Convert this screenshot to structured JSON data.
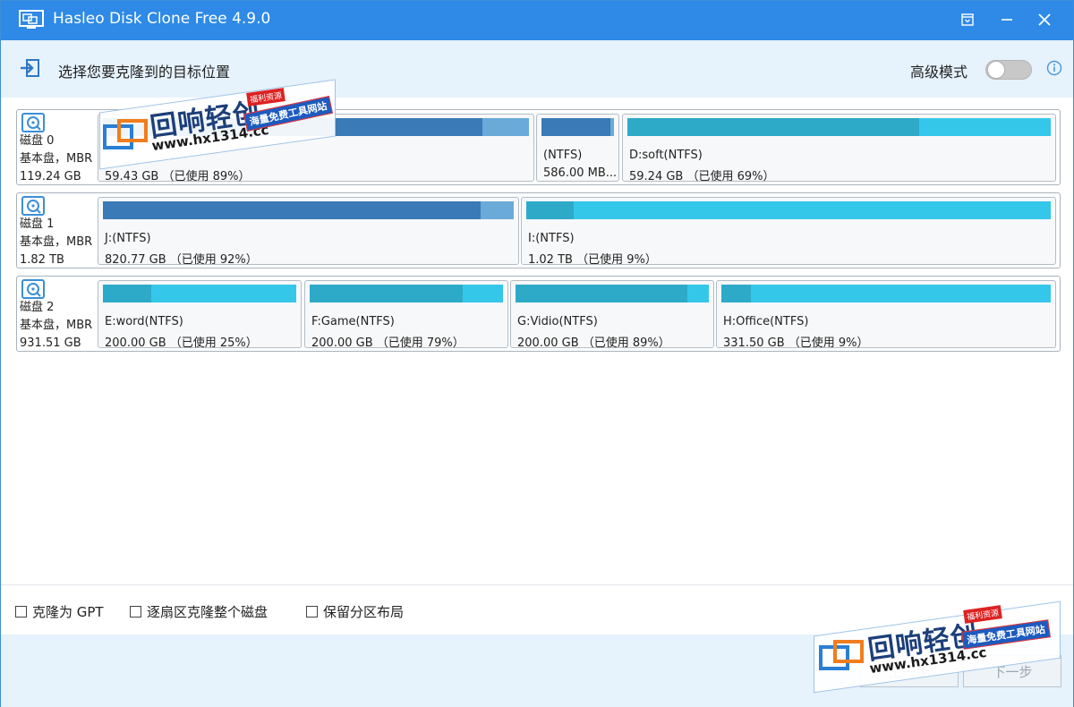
{
  "window": {
    "title": "Hasleo Disk Clone Free 4.9.0"
  },
  "titlebar": {
    "icons": [
      "app-icon",
      "restore-icon",
      "minimize-icon",
      "close-icon"
    ]
  },
  "header": {
    "step_label": "选择您要克隆到的目标位置",
    "advanced_label": "高级模式",
    "advanced_on": false
  },
  "disks": [
    {
      "name": "磁盘 0",
      "type": "基本盘，MBR",
      "size": "119.24 GB",
      "partitions": [
        {
          "label": "",
          "size_text": "59.43 GB （已使用 89%）",
          "used": 0.89,
          "style": "dark"
        },
        {
          "label": "(NTFS)",
          "size_text": "586.00 MB...",
          "used": 0.95,
          "style": "dark"
        },
        {
          "label": "D:soft(NTFS)",
          "size_text": "59.24 GB （已使用 69%）",
          "used": 0.69,
          "style": "light"
        }
      ]
    },
    {
      "name": "磁盘 1",
      "type": "基本盘，MBR",
      "size": "1.82 TB",
      "partitions": [
        {
          "label": "J:(NTFS)",
          "size_text": "820.77 GB （已使用 92%）",
          "used": 0.92,
          "style": "dark"
        },
        {
          "label": "I:(NTFS)",
          "size_text": "1.02 TB （已使用 9%）",
          "used": 0.09,
          "style": "light"
        }
      ]
    },
    {
      "name": "磁盘 2",
      "type": "基本盘，MBR",
      "size": "931.51 GB",
      "partitions": [
        {
          "label": "E:word(NTFS)",
          "size_text": "200.00 GB （已使用 25%）",
          "used": 0.25,
          "style": "light"
        },
        {
          "label": "F:Game(NTFS)",
          "size_text": "200.00 GB （已使用 79%）",
          "used": 0.79,
          "style": "light"
        },
        {
          "label": "G:Vidio(NTFS)",
          "size_text": "200.00 GB （已使用 89%）",
          "used": 0.89,
          "style": "light"
        },
        {
          "label": "H:Office(NTFS)",
          "size_text": "331.50 GB （已使用 9%）",
          "used": 0.09,
          "style": "light"
        }
      ]
    }
  ],
  "options": {
    "gpt": "克隆为 GPT",
    "sector": "逐扇区克隆整个磁盘",
    "keep_layout": "保留分区布局"
  },
  "footer": {
    "prev": "上一步",
    "next": "下一步"
  },
  "watermark": {
    "brand": "回响轻创",
    "url": "www.hx1314.cc",
    "slogan": "海量免费工具网站",
    "tag": "福利资源"
  },
  "colors": {
    "titlebar": "#2e8ae6",
    "header_bg": "#e6f2fc",
    "bar_dark": "#3a7ab6",
    "bar_light": "#35c7ea"
  }
}
